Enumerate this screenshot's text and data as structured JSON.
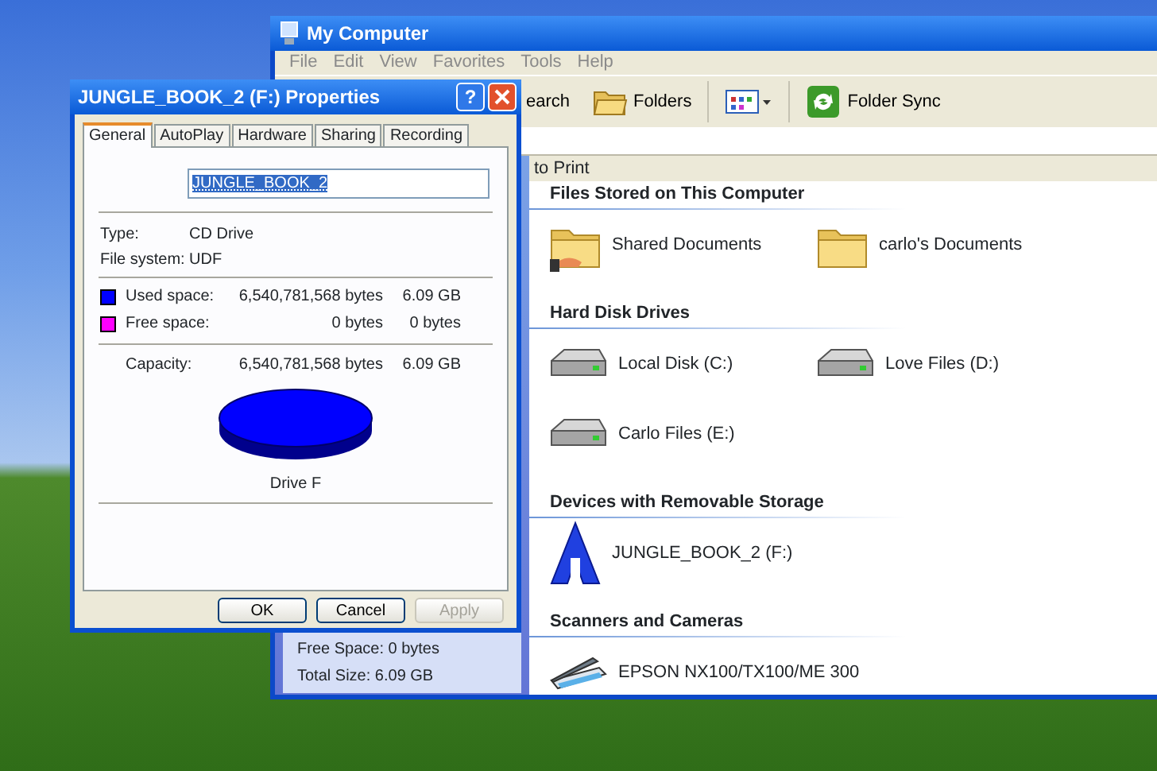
{
  "explorer": {
    "title": "My Computer",
    "menu": [
      "File",
      "Edit",
      "View",
      "Favorites",
      "Tools",
      "Help"
    ],
    "toolbar": [
      {
        "kind": "text",
        "label": "earch"
      },
      {
        "kind": "folders",
        "label": "Folders"
      },
      {
        "kind": "views"
      },
      {
        "kind": "sync",
        "label": "Folder Sync"
      }
    ],
    "task_strip": "to Print",
    "details": [
      "Free Space: 0 bytes",
      "Total Size: 6.09 GB"
    ],
    "groups": [
      {
        "heading": "Files Stored on This Computer",
        "items": [
          {
            "kind": "shared-folder",
            "label": "Shared Documents"
          },
          {
            "kind": "folder",
            "label": "carlo's Documents"
          }
        ]
      },
      {
        "heading": "Hard Disk Drives",
        "items": [
          {
            "kind": "drive",
            "label": "Local Disk (C:)"
          },
          {
            "kind": "drive",
            "label": "Love Files (D:)"
          },
          {
            "kind": "drive",
            "label": "Carlo Files (E:)"
          }
        ]
      },
      {
        "heading": "Devices with Removable Storage",
        "items": [
          {
            "kind": "removable",
            "label": "JUNGLE_BOOK_2 (F:)"
          }
        ]
      },
      {
        "heading": "Scanners and Cameras",
        "items": [
          {
            "kind": "scanner",
            "label": "EPSON NX100/TX100/ME 300"
          }
        ]
      }
    ]
  },
  "dialog": {
    "title": "JUNGLE_BOOK_2 (F:) Properties",
    "help_button": "?",
    "tabs": [
      {
        "label": "General",
        "selected": true
      },
      {
        "label": "AutoPlay",
        "selected": false
      },
      {
        "label": "Hardware",
        "selected": false
      },
      {
        "label": "Sharing",
        "selected": false
      },
      {
        "label": "Recording",
        "selected": false
      }
    ],
    "name_value": "JUNGLE_BOOK_2",
    "info": [
      {
        "label": "Type:",
        "value": "CD Drive"
      },
      {
        "label": "File system:",
        "value": "UDF"
      }
    ],
    "space": [
      {
        "label": "Used space:",
        "bytes": "6,540,781,568 bytes",
        "size": "6.09 GB",
        "color": "#0000ff"
      },
      {
        "label": "Free space:",
        "bytes": "0 bytes",
        "size": "0 bytes",
        "color": "#ff00ff"
      }
    ],
    "capacity": {
      "label": "Capacity:",
      "bytes": "6,540,781,568 bytes",
      "size": "6.09 GB"
    },
    "drive_label": "Drive F",
    "buttons": [
      {
        "label": "OK",
        "disabled": false
      },
      {
        "label": "Cancel",
        "disabled": false
      },
      {
        "label": "Apply",
        "disabled": true
      }
    ]
  }
}
